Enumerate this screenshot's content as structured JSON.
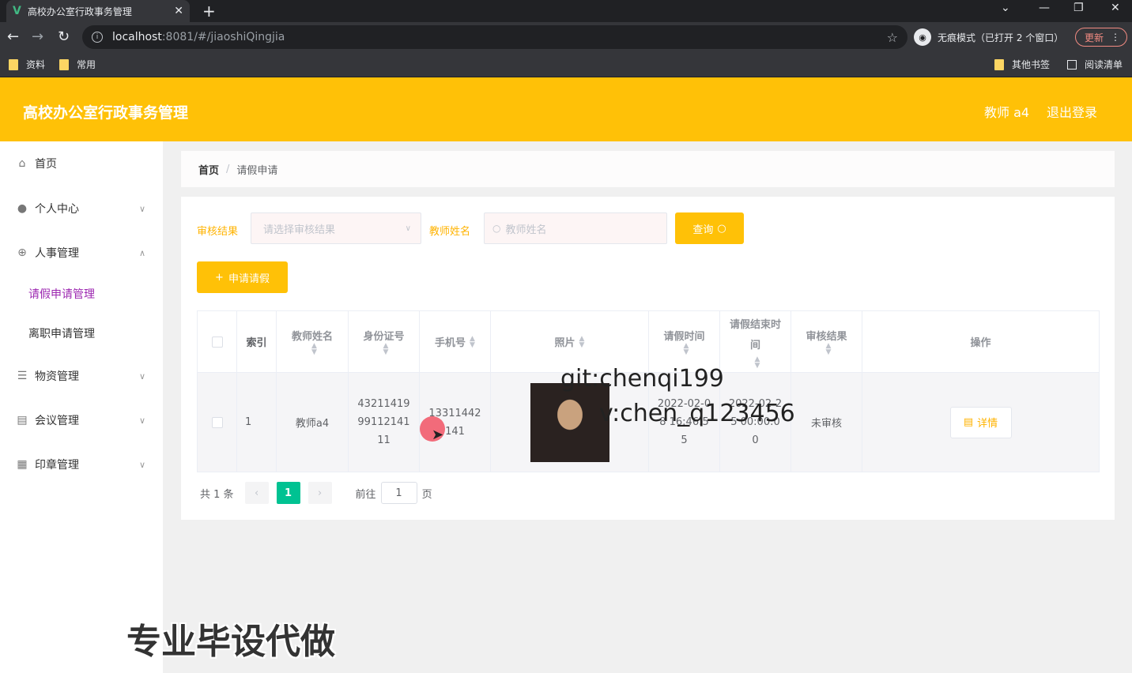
{
  "browser": {
    "tab_title": "高校办公室行政事务管理",
    "favicon": "V",
    "url_host": "localhost",
    "url_rest": ":8081/#/jiaoshiQingjia",
    "incognito_label": "无痕模式（已打开 2 个窗口）",
    "update_label": "更新",
    "bookmarks": [
      "资料",
      "常用"
    ],
    "bookmarks_right": [
      "其他书签",
      "阅读清单"
    ]
  },
  "header": {
    "title": "高校办公室行政事务管理",
    "user": "教师 a4",
    "logout": "退出登录"
  },
  "sidebar": {
    "items": [
      {
        "label": "首页",
        "icon": "home-icon"
      },
      {
        "label": "个人中心",
        "icon": "user-icon"
      },
      {
        "label": "人事管理",
        "icon": "globe-icon"
      },
      {
        "label": "物资管理",
        "icon": "list-icon"
      },
      {
        "label": "会议管理",
        "icon": "clipboard-icon"
      },
      {
        "label": "印章管理",
        "icon": "grid-icon"
      }
    ],
    "sub_items": [
      "请假申请管理",
      "离职申请管理"
    ]
  },
  "breadcrumb": {
    "home": "首页",
    "separator": "/",
    "current": "请假申请"
  },
  "filters": {
    "result_label": "审核结果",
    "result_placeholder": "请选择审核结果",
    "name_label": "教师姓名",
    "name_placeholder": "教师姓名",
    "query_button": "查询",
    "add_button": "申请请假"
  },
  "table": {
    "headers": [
      "索引",
      "教师姓名",
      "身份证号",
      "手机号",
      "照片",
      "请假时间",
      "请假结束时间",
      "审核结果",
      "操作"
    ],
    "rows": [
      {
        "index": "1",
        "name": "教师a4",
        "id_number": "432114199911214111",
        "phone": "13311442141",
        "start": "2022-02-08 16:46:55",
        "end": "2022-02-25 00:00:00",
        "result": "未审核",
        "action": "详情"
      }
    ]
  },
  "pager": {
    "total": "共 1 条",
    "current": "1",
    "goto_prefix": "前往",
    "goto_value": "1",
    "goto_suffix": "页"
  },
  "overlays": {
    "wm1": "git:chenqi199",
    "wm2": "v:chen_q123456",
    "bottom": "专业毕设代做"
  },
  "colors": {
    "accent": "#ffc107",
    "active_menu": "#9c27b0",
    "page_active": "#00c292"
  }
}
